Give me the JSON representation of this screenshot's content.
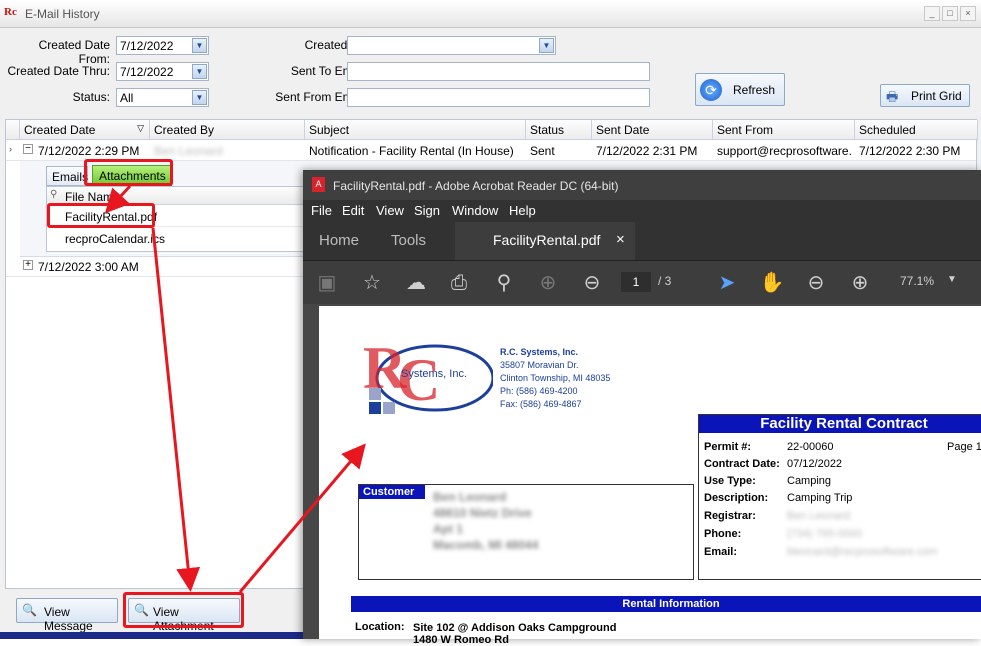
{
  "window": {
    "title": "E-Mail History",
    "minimize": "_",
    "maximize": "□",
    "close": "×"
  },
  "filters": {
    "created_date_from_label": "Created Date From:",
    "created_date_from": "7/12/2022",
    "created_date_thru_label": "Created Date Thru:",
    "created_date_thru": "7/12/2022",
    "status_label": "Status:",
    "status": "All",
    "created_by_label": "Created By:",
    "created_by": "",
    "sent_to_label": "Sent To Email:",
    "sent_to": "",
    "sent_from_label": "Sent From Email:",
    "sent_from": ""
  },
  "buttons": {
    "refresh": "Refresh",
    "print_grid": "Print Grid",
    "view_message": "View Message",
    "view_attachment": "View Attachment"
  },
  "grid": {
    "columns": [
      "Created Date",
      "Created By",
      "Subject",
      "Status",
      "Sent Date",
      "Sent From",
      "Scheduled"
    ],
    "rows": [
      {
        "created_date": "7/12/2022 2:29 PM",
        "created_by": "Ben Leonard",
        "subject": "Notification - Facility Rental (In House)",
        "status": "Sent",
        "sent_date": "7/12/2022 2:31 PM",
        "sent_from": "support@recprosoftware...",
        "scheduled": "7/12/2022 2:30 PM"
      },
      {
        "created_date": "7/12/2022 3:00 AM"
      }
    ],
    "detail_tabs": [
      "Emails",
      "Attachments"
    ],
    "attachments_header": "File Name",
    "attachments": [
      "FacilityRental.pdf",
      "recproCalendar.ics"
    ]
  },
  "acrobat": {
    "title": "FacilityRental.pdf - Adobe Acrobat Reader DC (64-bit)",
    "menu": [
      "File",
      "Edit",
      "View",
      "Sign",
      "Window",
      "Help"
    ],
    "tabs": {
      "home": "Home",
      "tools": "Tools",
      "doc": "FacilityRental.pdf",
      "close": "×"
    },
    "page_current": "1",
    "page_total": "/ 3",
    "zoom": "77.1%"
  },
  "pdf": {
    "company": "R.C. Systems, Inc.",
    "address1": "35807 Moravian Dr.",
    "address2": "Clinton Township, MI 48035",
    "phone": "Ph: (586) 469-4200",
    "fax": "Fax: (586) 469-4867",
    "logo_text": "Systems, Inc.",
    "contract_title": "Facility Rental Contract",
    "permit_label": "Permit #:",
    "permit": "22-00060",
    "page_label": "Page 1",
    "contract_date_label": "Contract Date:",
    "contract_date": "07/12/2022",
    "use_type_label": "Use Type:",
    "use_type": "Camping",
    "description_label": "Description:",
    "description": "Camping Trip",
    "registrar_label": "Registrar:",
    "registrar": "Ben Leonard",
    "phone_label": "Phone:",
    "phone_val": "(734) 765-0000",
    "email_label": "Email:",
    "email_val": "bleonard@recprosoftware.com",
    "customer_label": "Customer",
    "customer_lines": [
      "Ben Leonard",
      "48610 Nietz Drive",
      "Apt 1",
      "Macomb, MI 48044"
    ],
    "rental_info": "Rental Information",
    "location_label": "Location:",
    "location1": "Site 102 @ Addison Oaks Campground",
    "location2": "1480 W Romeo Rd"
  },
  "colors": {
    "accent": "#0a14b8",
    "annotation": "#e8161f",
    "attachments_tab": "#7fd23f"
  }
}
